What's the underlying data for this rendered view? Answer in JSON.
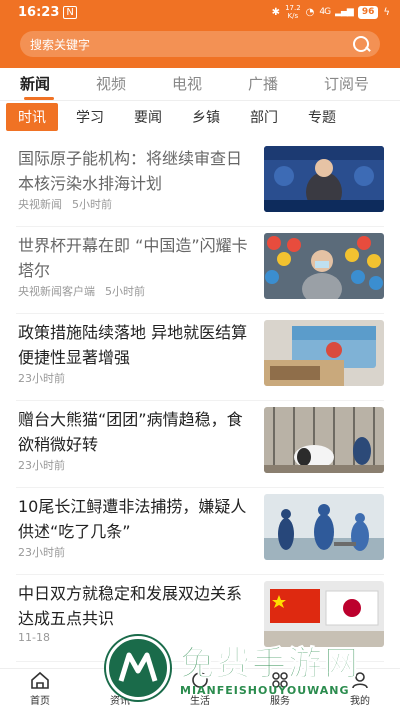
{
  "status": {
    "time": "16:23",
    "net_top": "17.2",
    "net_bottom": "K/s",
    "signal": "4G",
    "battery": "96"
  },
  "search": {
    "placeholder": "搜索关键字"
  },
  "tabs": [
    {
      "label": "新闻",
      "active": true
    },
    {
      "label": "视频"
    },
    {
      "label": "电视"
    },
    {
      "label": "广播"
    },
    {
      "label": "订阅号"
    }
  ],
  "subtabs": [
    {
      "label": "时讯",
      "active": true
    },
    {
      "label": "学习"
    },
    {
      "label": "要闻"
    },
    {
      "label": "乡镇"
    },
    {
      "label": "部门"
    },
    {
      "label": "专题"
    }
  ],
  "news": [
    {
      "title": "国际原子能机构：将继续审查日本核污染水排海计划",
      "source": "央视新闻",
      "time": "5小时前",
      "read": true
    },
    {
      "title": "世界杯开幕在即 “中国造”闪耀卡塔尔",
      "source": "央视新闻客户端",
      "time": "5小时前",
      "read": true
    },
    {
      "title": "政策措施陆续落地 异地就医结算便捷性显著增强",
      "source": "",
      "time": "23小时前",
      "read": false
    },
    {
      "title": "赠台大熊猫“团团”病情趋稳，食欲稍微好转",
      "source": "",
      "time": "23小时前",
      "read": false
    },
    {
      "title": "10尾长江鲟遭非法捕捞，嫌疑人供述“吃了几条”",
      "source": "",
      "time": "23小时前",
      "read": false
    },
    {
      "title": "中日双方就稳定和发展双边关系达成五点共识",
      "source": "",
      "time": "11-18",
      "read": false
    }
  ],
  "bottomnav": [
    {
      "label": "首页",
      "icon": "home-icon"
    },
    {
      "label": "资讯",
      "icon": "news-icon"
    },
    {
      "label": "生活",
      "icon": "life-icon"
    },
    {
      "label": "服务",
      "icon": "service-icon"
    },
    {
      "label": "我的",
      "icon": "user-icon"
    }
  ],
  "watermark": {
    "title": "免费手游网",
    "subtitle": "MIANFEISHOUYOUWANG"
  },
  "colors": {
    "accent": "#f07224",
    "watermark": "#2b8c4e"
  }
}
